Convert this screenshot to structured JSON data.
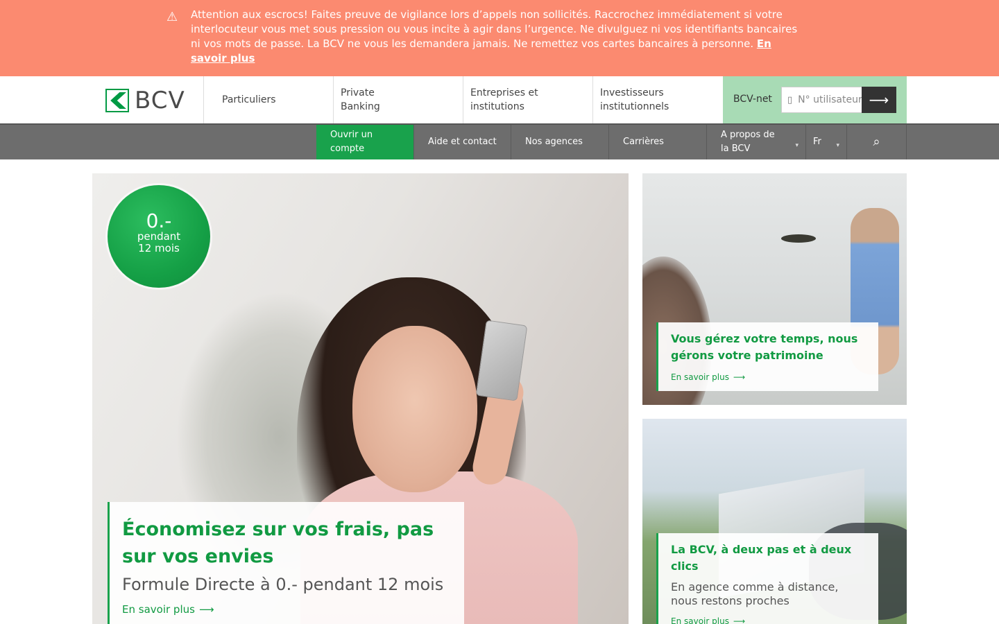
{
  "alert": {
    "icon": "warning-icon",
    "text": "Attention aux escrocs! Faites preuve de vigilance lors d’appels non sollicités. Raccrochez immédiatement si votre interlocuteur vous met sous pression ou vous incite à agir dans l’urgence. Ne divulguez ni vos identifiants bancaires ni vos mots de passe. La BCV ne vous les demandera jamais. Ne remettez vos cartes bancaires à personne.",
    "link": "En savoir plus",
    "color": "#fb8a70"
  },
  "logo": {
    "text": "BCV"
  },
  "main_nav": {
    "items": [
      {
        "label": "Particuliers"
      },
      {
        "label": "Private Banking"
      },
      {
        "label": "Entreprises et institutions"
      },
      {
        "label": "Investisseurs institutionnels"
      }
    ]
  },
  "bcvnet": {
    "label": "BCV-net",
    "placeholder": "N° utilisateur",
    "user_icon": "user-icon",
    "submit_icon": "arrow-right-icon"
  },
  "sub_nav": {
    "open_account": "Ouvrir un compte",
    "help": "Aide et contact",
    "agencies": "Nos agences",
    "careers": "Carrières",
    "about": "A propos de la BCV",
    "lang": "Fr",
    "search_icon": "search-icon"
  },
  "hero": {
    "badge_big": "0.-",
    "badge_line1": "pendant",
    "badge_line2": "12 mois",
    "title": "Économisez sur vos frais, pas sur vos envies",
    "subtitle": "Formule Directe à 0.- pendant 12 mois",
    "more": "En savoir plus"
  },
  "card1": {
    "title": "Vous gérez votre temps, nous gérons votre patrimoine",
    "more": "En savoir plus"
  },
  "card2": {
    "title": "La BCV, à deux pas et à deux clics",
    "subtitle": "En agence comme à distance, nous restons proches",
    "more": "En savoir plus"
  },
  "colors": {
    "brand_green": "#19a24c",
    "subnav": "#6d6d6d",
    "bcvnet_bg": "#a8dbb5"
  }
}
